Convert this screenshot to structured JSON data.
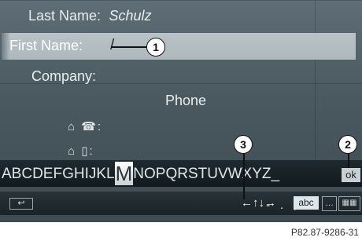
{
  "form": {
    "last_name_label": "Last Name:",
    "last_name_value": "Schulz",
    "first_name_label": "First Name:",
    "first_name_cursor": "/",
    "company_label": "Company:",
    "phone_label": "Phone",
    "home_phone_icons": "⌂ ☎:",
    "home_mobile_icons": "⌂ ▯:"
  },
  "keyboard": {
    "chars_before": "ABCDEFGHIJKL",
    "selected_char": "M",
    "chars_after": "NOPQRSTUVWXYZ_",
    "ok_label": "ok"
  },
  "bottom_bar": {
    "back_label": "↩",
    "arrows": "←↑↓→",
    "punctuation": "- . ,",
    "abc_label": "abc",
    "more_label": "…",
    "img_label": "▦▦"
  },
  "callouts": {
    "c1": "1",
    "c2": "2",
    "c3": "3"
  },
  "caption": "P82.87-9286-31"
}
